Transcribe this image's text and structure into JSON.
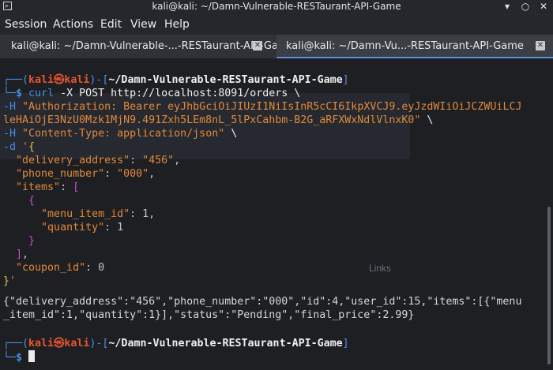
{
  "window": {
    "title": "kali@kali: ~/Damn-Vulnerable-RESTaurant-API-Game",
    "controls": {
      "minimize": "▾",
      "restore": "○",
      "close": "✕"
    }
  },
  "menu": [
    "Session",
    "Actions",
    "Edit",
    "View",
    "Help"
  ],
  "tabs": [
    {
      "label": "kali@kali: ~/Damn-Vulnerable-...-RESTaurant-API-Game",
      "active": false
    },
    {
      "label": "kali@kali: ~/Damn-Vu...-RESTaurant-API-Game",
      "active": true
    }
  ],
  "prompt": {
    "user": "kali",
    "at": "㉿",
    "host": "kali",
    "path": "~/Damn-Vulnerable-RESTaurant-API-Game",
    "symbol": "$"
  },
  "command": {
    "cmd": "curl",
    "l1": " -X POST http://localhost:8091/orders \\",
    "h_flag": "-H",
    "auth_a": "\"Authorization: Bearer eyJhbGciOiJIUzI1NiIsInR5cCI6IkpXVCJ9.eyJzdWIiOiJCZWUiLCJ",
    "auth_b": "leHAiOjE3NzU0Mzk1MjN9.491Zxh5LEm8nL_5lPxCahbm-B2G_aRFXWxNdlVlnxK0\"",
    "auth_tail": " \\",
    "ctype": "\"Content-Type: application/json\"",
    "ctype_tail": " \\",
    "d_flag": "-d",
    "body": {
      "delivery_key": "\"delivery_address\"",
      "delivery_val": "\"456\"",
      "phone_key": "\"phone_number\"",
      "phone_val": "\"000\"",
      "items_key": "\"items\"",
      "menu_key": "\"menu_item_id\"",
      "menu_val": "1",
      "qty_key": "\"quantity\"",
      "qty_val": "1",
      "coupon_key": "\"coupon_id\"",
      "coupon_val": "0"
    }
  },
  "response": {
    "line1": "{\"delivery_address\":\"456\",\"phone_number\":\"000\",\"id\":4,\"user_id\":15,\"items\":[{\"menu",
    "line2": "_item_id\":1,\"quantity\":1}],\"status\":\"Pending\",\"final_price\":2.99}"
  },
  "background_overlay": {
    "link": "Links",
    "faint": "..."
  }
}
